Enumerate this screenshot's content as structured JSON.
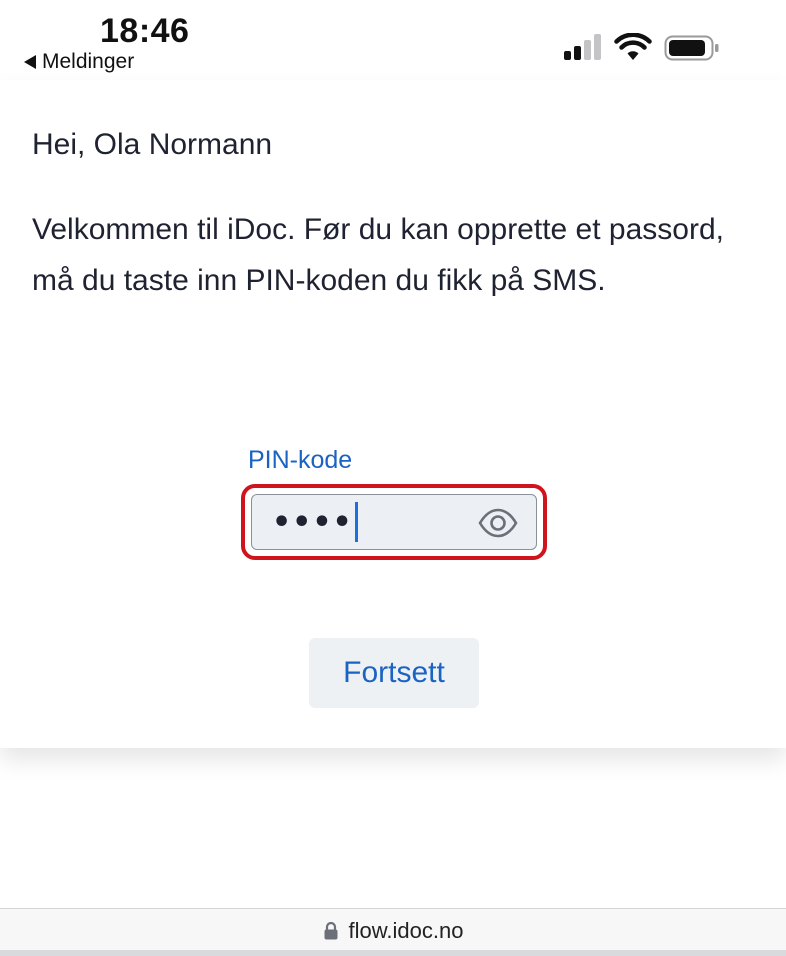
{
  "status_bar": {
    "time": "18:46",
    "back_label": "Meldinger",
    "icons": [
      "signal-icon",
      "wifi-icon",
      "battery-icon"
    ]
  },
  "page": {
    "greeting": "Hei, Ola Normann",
    "intro": "Velkommen til iDoc. Før du kan opprette et passord, må du taste inn PIN-koden du fikk på SMS."
  },
  "pin": {
    "label": "PIN-kode",
    "masked_value": "••••",
    "toggle_icon": "eye-icon"
  },
  "actions": {
    "continue_label": "Fortsett"
  },
  "browser": {
    "url": "flow.idoc.no",
    "lock_icon": "lock-icon"
  },
  "colors": {
    "link_blue": "#1b63c2",
    "error_red": "#d0141d",
    "text": "#1f2230"
  }
}
